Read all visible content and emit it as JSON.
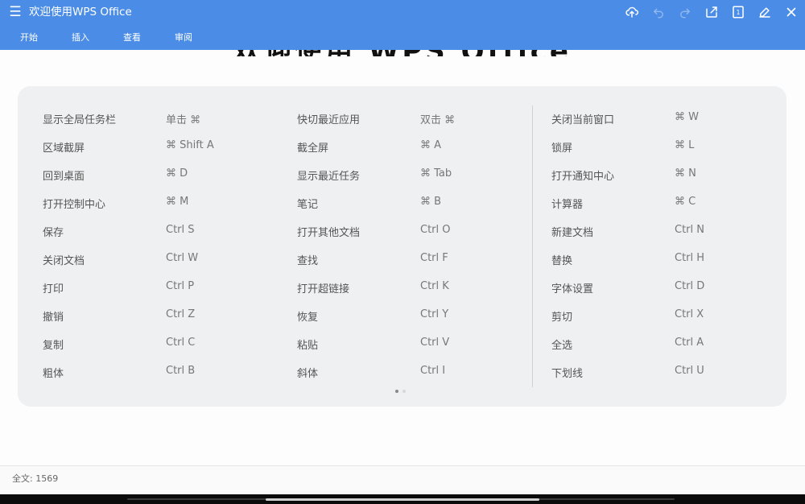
{
  "app": {
    "title": "欢迎使用WPS Office",
    "accent_color": "#4a8ce6"
  },
  "toolbar": {
    "icons": [
      "cloud-upload-icon",
      "undo-icon",
      "redo-icon",
      "share-icon",
      "page-count-icon",
      "edit-icon",
      "close-icon"
    ],
    "page_count": "1"
  },
  "tabs": [
    "开始",
    "插入",
    "查看",
    "审阅"
  ],
  "document": {
    "heading_peek": "欢迎使用 WPS Office"
  },
  "shortcuts": {
    "col1": [
      {
        "name": "显示全局任务栏",
        "key": "单击 ⌘"
      },
      {
        "name": "区域截屏",
        "key": "⌘ Shift A"
      },
      {
        "name": "回到桌面",
        "key": "⌘ D"
      },
      {
        "name": "打开控制中心",
        "key": "⌘ M"
      },
      {
        "name": "保存",
        "key": "Ctrl S"
      },
      {
        "name": "关闭文档",
        "key": "Ctrl W"
      },
      {
        "name": "打印",
        "key": "Ctrl P"
      },
      {
        "name": "撤销",
        "key": "Ctrl Z"
      },
      {
        "name": "复制",
        "key": "Ctrl C"
      },
      {
        "name": "粗体",
        "key": "Ctrl B"
      }
    ],
    "col2": [
      {
        "name": "快切最近应用",
        "key": "双击 ⌘"
      },
      {
        "name": "截全屏",
        "key": "⌘ A"
      },
      {
        "name": "显示最近任务",
        "key": "⌘ Tab"
      },
      {
        "name": "笔记",
        "key": "⌘ B"
      },
      {
        "name": "打开其他文档",
        "key": "Ctrl O"
      },
      {
        "name": "查找",
        "key": "Ctrl F"
      },
      {
        "name": "打开超链接",
        "key": "Ctrl K"
      },
      {
        "name": "恢复",
        "key": "Ctrl Y"
      },
      {
        "name": "粘贴",
        "key": "Ctrl V"
      },
      {
        "name": "斜体",
        "key": "Ctrl I"
      }
    ],
    "col3": [
      {
        "name": "关闭当前窗口",
        "key": "⌘ W"
      },
      {
        "name": "锁屏",
        "key": "⌘ L"
      },
      {
        "name": "打开通知中心",
        "key": "⌘ N"
      },
      {
        "name": "计算器",
        "key": "⌘ C"
      },
      {
        "name": "新建文档",
        "key": "Ctrl N"
      },
      {
        "name": "替换",
        "key": "Ctrl H"
      },
      {
        "name": "字体设置",
        "key": "Ctrl D"
      },
      {
        "name": "剪切",
        "key": "Ctrl X"
      },
      {
        "name": "全选",
        "key": "Ctrl A"
      },
      {
        "name": "下划线",
        "key": "Ctrl U"
      }
    ]
  },
  "pager": {
    "count": 2,
    "active": 0
  },
  "status": {
    "word_count": "全文: 1569"
  }
}
